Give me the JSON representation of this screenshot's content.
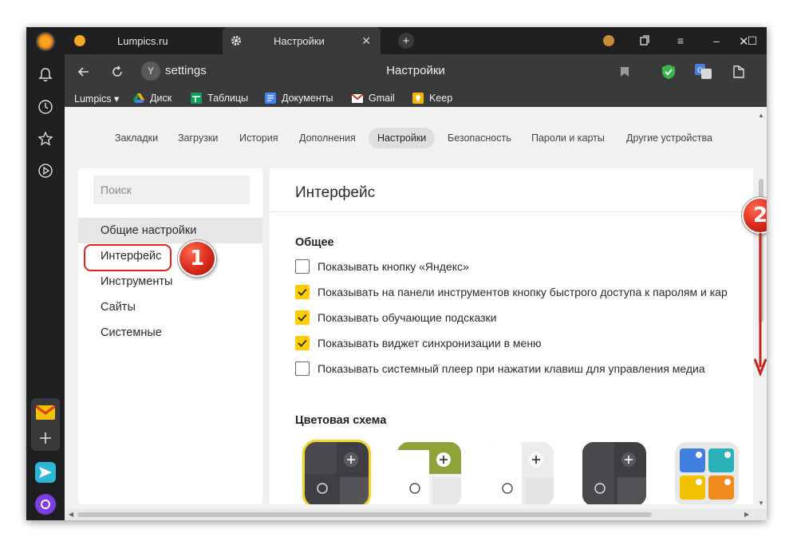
{
  "tabs": [
    {
      "label": "Lumpics.ru"
    },
    {
      "label": "Настройки"
    }
  ],
  "address": {
    "text": "settings"
  },
  "page_title": "Настройки",
  "bookmarks": [
    {
      "label": "Lumpics ▾"
    },
    {
      "label": "Диск"
    },
    {
      "label": "Таблицы"
    },
    {
      "label": "Документы"
    },
    {
      "label": "Gmail"
    },
    {
      "label": "Keep"
    }
  ],
  "topnav": [
    {
      "label": "Закладки"
    },
    {
      "label": "Загрузки"
    },
    {
      "label": "История"
    },
    {
      "label": "Дополнения"
    },
    {
      "label": "Настройки"
    },
    {
      "label": "Безопасность"
    },
    {
      "label": "Пароли и карты"
    },
    {
      "label": "Другие устройства"
    }
  ],
  "sidebar": {
    "search_placeholder": "Поиск",
    "items": [
      {
        "label": "Общие настройки"
      },
      {
        "label": "Интерфейс"
      },
      {
        "label": "Инструменты"
      },
      {
        "label": "Сайты"
      },
      {
        "label": "Системные"
      }
    ]
  },
  "content": {
    "section_title": "Интерфейс",
    "general_title": "Общее",
    "options": [
      {
        "label": "Показывать кнопку «Яндекс»",
        "checked": false
      },
      {
        "label": "Показывать на панели инструментов кнопку быстрого доступа к паролям и кар",
        "checked": true
      },
      {
        "label": "Показывать обучающие подсказки",
        "checked": true
      },
      {
        "label": "Показывать виджет синхронизации в меню",
        "checked": true
      },
      {
        "label": "Показывать системный плеер при нажатии клавиш для управления медиа",
        "checked": false
      }
    ],
    "color_scheme_title": "Цветовая схема"
  },
  "annotations": [
    {
      "number": "1"
    },
    {
      "number": "2"
    }
  ],
  "colors": {
    "accent_checkbox": "#ffcc00",
    "annotation_red": "#d8291b",
    "theme_selected_outline": "#f6d12a"
  }
}
